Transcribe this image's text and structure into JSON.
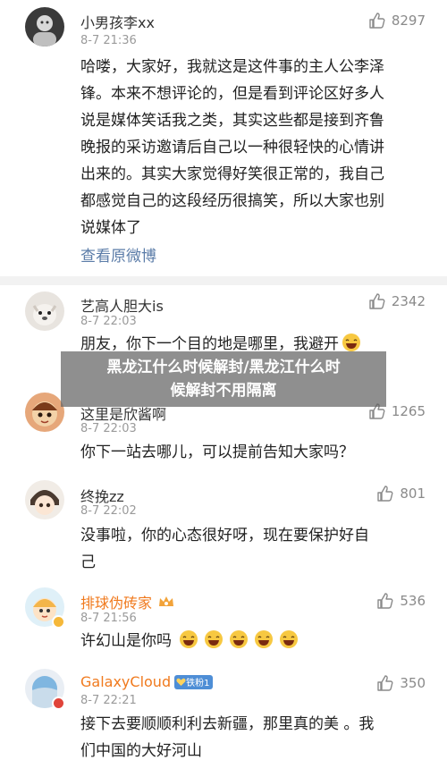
{
  "post": {
    "user": "小男孩李xx",
    "time": "8-7 21:36",
    "likes": "8297",
    "lines": [
      "哈喽，大家好，我就这是这件事的主人公李泽",
      "锋。本来不想评论的，但是看到评论区好多人",
      "说是媒体笑话我之类，其实这些都是接到齐鲁",
      "晚报的采访邀请后自己以一种很轻快的心情讲",
      "出来的。其实大家觉得好笑很正常的，我自己",
      "都感觉自己的这段经历很搞笑，所以大家也别",
      "说媒体了"
    ],
    "view_original": "查看原微博"
  },
  "comments": [
    {
      "user": "艺高人胆大is",
      "time": "8-7 22:03",
      "likes": "2342",
      "lines": [
        "朋友，你下一个目的地是哪里，我避开"
      ]
    },
    {
      "user": "这里是欣酱啊",
      "time": "8-7 22:03",
      "likes": "1265",
      "lines": [
        "你下一站去哪儿，可以提前告知大家吗？"
      ]
    },
    {
      "user": "终挽zz",
      "time": "8-7 22:02",
      "likes": "801",
      "lines": [
        "没事啦，你的心态很好呀，现在要保护好自",
        "己"
      ]
    },
    {
      "user": "排球伪砖家",
      "time": "8-7 21:56",
      "likes": "536",
      "lines": [
        "许幻山是你吗"
      ]
    },
    {
      "user": "GalaxyCloud",
      "fan_badge": "铁粉1",
      "time": "8-7 22:21",
      "likes": "350",
      "lines": [
        "接下去要顺顺利利去新疆，那里真的美 。我",
        "们中国的大好河山"
      ]
    }
  ],
  "overlay": {
    "line1": "黑龙江什么时候解封/黑龙江什么时",
    "line2": "候解封不用隔离"
  },
  "colors": {
    "orange_name": "#f07a1e",
    "link_blue": "#5b7ca8",
    "fan_badge": "#4e8ed6"
  },
  "icons": [
    "thumbs-up-icon",
    "laughing-emoji-icon",
    "crown-icon",
    "verified-badge-icon"
  ]
}
